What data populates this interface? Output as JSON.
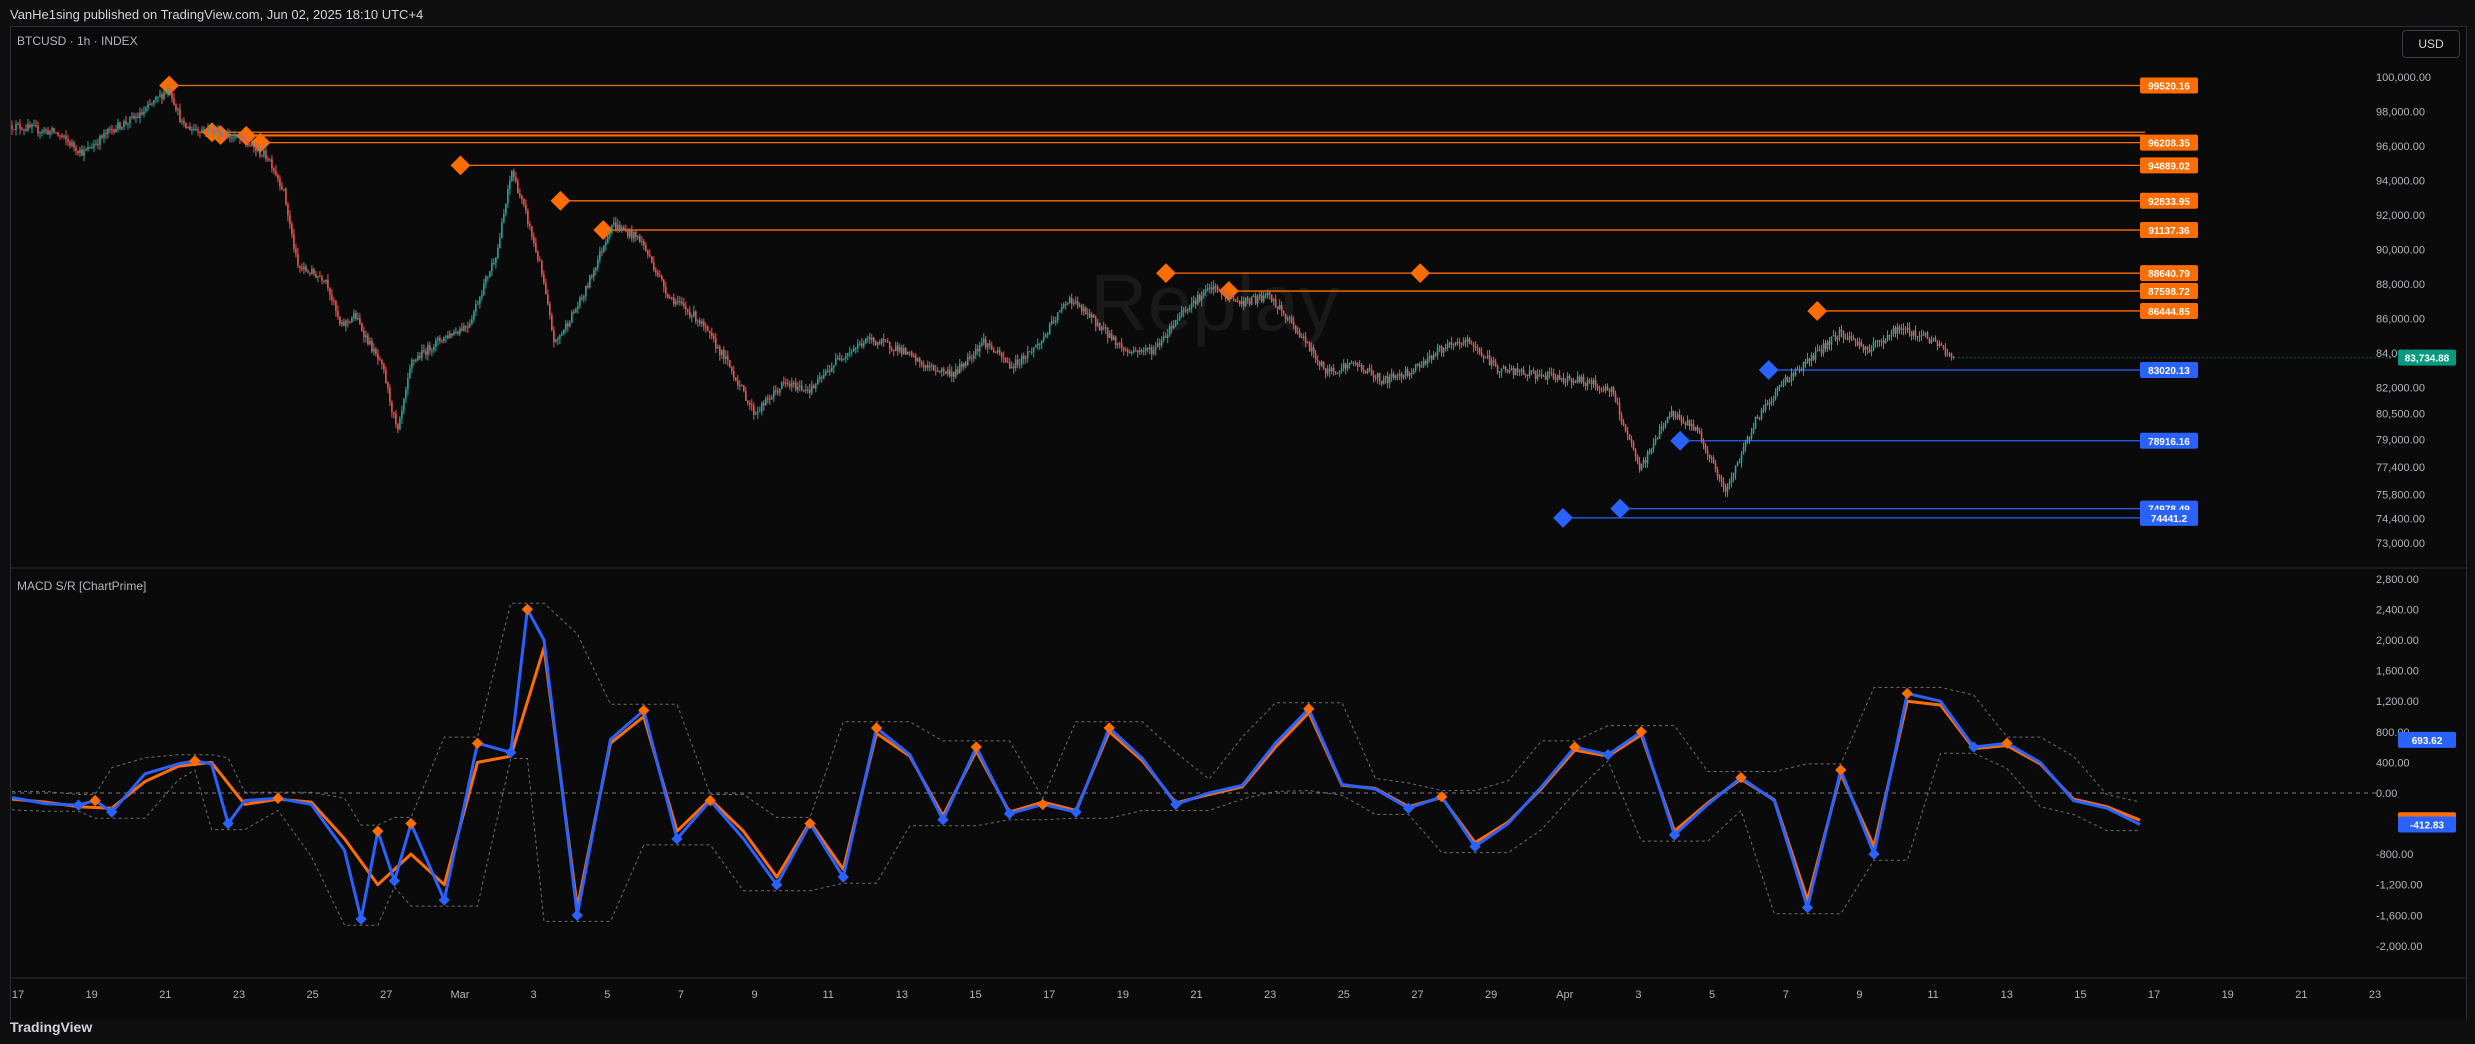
{
  "header": {
    "published": "VanHe1sing published on TradingView.com, Jun 02, 2025 18:10 UTC+4"
  },
  "footer": {
    "logo": "TradingView"
  },
  "price_pane": {
    "symbol": "BTCUSD · 1h · INDEX",
    "currency": "USD",
    "watermark": "Replay"
  },
  "macd_pane": {
    "title": "MACD S/R [ChartPrime]"
  },
  "colors": {
    "bull": "#26a69a",
    "bear": "#ef5350",
    "resistance": "#ff6d00",
    "support": "#2962ff",
    "macd": "#2962ff",
    "signal": "#ff6d00",
    "current_price": "#089981"
  },
  "chart_data": [
    {
      "type": "candlestick",
      "title": "BTCUSD · 1h · INDEX",
      "x_ticks": [
        "17",
        "19",
        "21",
        "23",
        "25",
        "27",
        "Mar",
        "3",
        "5",
        "7",
        "9",
        "11",
        "13",
        "15",
        "17",
        "19",
        "21",
        "23",
        "25",
        "27",
        "29",
        "Apr",
        "3",
        "5",
        "7",
        "9",
        "11",
        "13",
        "15",
        "17",
        "19",
        "21",
        "23"
      ],
      "y_ticks": [
        "100,000.00",
        "98,000.00",
        "96,000.00",
        "94,000.00",
        "92,000.00",
        "90,000.00",
        "88,000.00",
        "86,000.00",
        "84,000.00",
        "82,000.00",
        "80,500.00",
        "79,000.00",
        "77,400.00",
        "75,800.00",
        "74,400.00",
        "73,000.00"
      ],
      "y_tick_values": [
        100000,
        98000,
        96000,
        94000,
        92000,
        90000,
        88000,
        86000,
        84000,
        82000,
        80500,
        79000,
        77400,
        75800,
        74400,
        73000
      ],
      "ylim": [
        72000,
        101000
      ],
      "x_range": [
        0,
        74.5
      ],
      "close_path": [
        [
          0,
          97200
        ],
        [
          1.5,
          96800
        ],
        [
          2.5,
          95600
        ],
        [
          3.5,
          97000
        ],
        [
          4.5,
          97800
        ],
        [
          5.5,
          99400
        ],
        [
          6,
          97100
        ],
        [
          7,
          96900
        ],
        [
          8,
          96400
        ],
        [
          9,
          95300
        ],
        [
          9.5,
          93500
        ],
        [
          10,
          89000
        ],
        [
          11,
          88300
        ],
        [
          11.5,
          85500
        ],
        [
          12,
          86200
        ],
        [
          13,
          83000
        ],
        [
          13.5,
          79300
        ],
        [
          14,
          83500
        ],
        [
          15,
          84800
        ],
        [
          16,
          85700
        ],
        [
          17,
          90000
        ],
        [
          17.5,
          94600
        ],
        [
          18,
          92000
        ],
        [
          18.5,
          89000
        ],
        [
          19,
          84500
        ],
        [
          20,
          87300
        ],
        [
          21,
          91500
        ],
        [
          22,
          90600
        ],
        [
          23,
          87300
        ],
        [
          24,
          86000
        ],
        [
          25,
          83600
        ],
        [
          26,
          80500
        ],
        [
          27,
          82200
        ],
        [
          28,
          81900
        ],
        [
          29,
          83800
        ],
        [
          30,
          84800
        ],
        [
          31,
          84300
        ],
        [
          32,
          83200
        ],
        [
          33,
          82800
        ],
        [
          34,
          84700
        ],
        [
          35,
          83200
        ],
        [
          36,
          84600
        ],
        [
          37,
          87200
        ],
        [
          38,
          85700
        ],
        [
          39,
          84100
        ],
        [
          40,
          84200
        ],
        [
          41,
          86500
        ],
        [
          42,
          87800
        ],
        [
          43,
          86900
        ],
        [
          44,
          87300
        ],
        [
          45,
          85300
        ],
        [
          46,
          82900
        ],
        [
          47,
          83400
        ],
        [
          48,
          82400
        ],
        [
          49,
          83000
        ],
        [
          50,
          84200
        ],
        [
          51,
          84700
        ],
        [
          52,
          83100
        ],
        [
          53,
          82800
        ],
        [
          54,
          82600
        ],
        [
          55,
          82400
        ],
        [
          56,
          81800
        ],
        [
          57,
          77200
        ],
        [
          58,
          80500
        ],
        [
          59,
          79600
        ],
        [
          60,
          75900
        ],
        [
          61,
          80000
        ],
        [
          62,
          82300
        ],
        [
          63,
          83700
        ],
        [
          64,
          85200
        ],
        [
          65,
          84200
        ],
        [
          66,
          85400
        ],
        [
          67,
          85000
        ],
        [
          68,
          83700
        ]
      ],
      "resistance_levels": [
        {
          "start": 5.5,
          "value": 99520.16,
          "label": "99520.16"
        },
        {
          "start": 7.0,
          "value": 96808.89
        },
        {
          "start": 7.3,
          "value": 96646.51
        },
        {
          "start": 8.2,
          "value": 96600.62
        },
        {
          "start": 8.7,
          "value": 96208.35,
          "label": "96208.35"
        },
        {
          "start": 15.7,
          "value": 94889.02,
          "label": "94889.02"
        },
        {
          "start": 19.2,
          "value": 92833.95,
          "label": "92833.95"
        },
        {
          "start": 20.7,
          "value": 91137.36,
          "label": "91137.36"
        },
        {
          "start": 40.4,
          "value": 88640.79,
          "label": "88640.79"
        },
        {
          "start": 49.3,
          "value": 88640.79
        },
        {
          "start": 42.6,
          "value": 87598.72,
          "label": "87598.72"
        },
        {
          "start": 63.2,
          "value": 86444.85,
          "label": "86444.85"
        }
      ],
      "support_levels": [
        {
          "start": 61.5,
          "value": 83020.13,
          "label": "83020.13"
        },
        {
          "start": 58.4,
          "value": 78916.16,
          "label": "78916.16"
        },
        {
          "start": 56.3,
          "value": 74978.49,
          "label": "74978.49"
        },
        {
          "start": 54.3,
          "value": 74441.2,
          "label": "74441.2"
        }
      ],
      "current_price": {
        "value": 83734.88,
        "label": "83,734.88"
      }
    },
    {
      "type": "line",
      "title": "MACD S/R [ChartPrime]",
      "y_ticks": [
        "2,800.00",
        "2,400.00",
        "2,000.00",
        "1,600.00",
        "1,200.00",
        "800.00",
        "400.00",
        "0.00",
        "-800.00",
        "-1,200.00",
        "-1,600.00",
        "-2,000.00"
      ],
      "y_tick_values": [
        2800,
        2400,
        2000,
        1600,
        1200,
        800,
        400,
        0,
        -800,
        -1200,
        -1600,
        -2000
      ],
      "ylim": [
        -2250,
        2850
      ],
      "zero_line": true,
      "series": [
        {
          "values": [
            [
              0,
              -60
            ],
            [
              1,
              -140
            ],
            [
              2,
              -160
            ],
            [
              2.5,
              -100
            ],
            [
              3,
              -250
            ],
            [
              4,
              250
            ],
            [
              5,
              380
            ],
            [
              5.5,
              420
            ],
            [
              6,
              380
            ],
            [
              6.5,
              -400
            ],
            [
              7,
              -100
            ],
            [
              8,
              -70
            ],
            [
              9,
              -150
            ],
            [
              10,
              -750
            ],
            [
              10.5,
              -1650
            ],
            [
              11,
              -500
            ],
            [
              11.5,
              -1150
            ],
            [
              12,
              -400
            ],
            [
              13,
              -1400
            ],
            [
              14,
              650
            ],
            [
              15,
              530
            ],
            [
              15.5,
              2400
            ],
            [
              16,
              2000
            ],
            [
              17,
              -1600
            ],
            [
              18,
              700
            ],
            [
              19,
              1080
            ],
            [
              20,
              -600
            ],
            [
              21,
              -100
            ],
            [
              22,
              -600
            ],
            [
              23,
              -1200
            ],
            [
              24,
              -400
            ],
            [
              25,
              -1100
            ],
            [
              26,
              850
            ],
            [
              27,
              500
            ],
            [
              28,
              -350
            ],
            [
              29,
              600
            ],
            [
              30,
              -270
            ],
            [
              31,
              -150
            ],
            [
              32,
              -250
            ],
            [
              33,
              850
            ],
            [
              34,
              450
            ],
            [
              35,
              -150
            ],
            [
              36,
              0
            ],
            [
              37,
              100
            ],
            [
              38,
              650
            ],
            [
              39,
              1100
            ],
            [
              40,
              110
            ],
            [
              41,
              50
            ],
            [
              42,
              -200
            ],
            [
              43,
              -50
            ],
            [
              44,
              -700
            ],
            [
              45,
              -400
            ],
            [
              46,
              80
            ],
            [
              47,
              600
            ],
            [
              48,
              500
            ],
            [
              49,
              800
            ],
            [
              50,
              -550
            ],
            [
              51,
              -150
            ],
            [
              52,
              200
            ],
            [
              53,
              -100
            ],
            [
              54,
              -1500
            ],
            [
              55,
              300
            ],
            [
              56,
              -800
            ],
            [
              57,
              1300
            ],
            [
              58,
              1200
            ],
            [
              59,
              600
            ],
            [
              60,
              650
            ],
            [
              61,
              400
            ],
            [
              62,
              -100
            ],
            [
              63,
              -200
            ],
            [
              64,
              -413
            ]
          ]
        },
        {
          "values": [
            [
              0,
              -80
            ],
            [
              1,
              -120
            ],
            [
              2,
              -180
            ],
            [
              3,
              -200
            ],
            [
              4,
              150
            ],
            [
              5,
              350
            ],
            [
              6,
              400
            ],
            [
              7,
              -150
            ],
            [
              8,
              -80
            ],
            [
              9,
              -120
            ],
            [
              10,
              -600
            ],
            [
              11,
              -1200
            ],
            [
              12,
              -800
            ],
            [
              13,
              -1200
            ],
            [
              14,
              400
            ],
            [
              15,
              480
            ],
            [
              16,
              1900
            ],
            [
              17,
              -1500
            ],
            [
              18,
              650
            ],
            [
              19,
              1000
            ],
            [
              20,
              -500
            ],
            [
              21,
              -80
            ],
            [
              22,
              -500
            ],
            [
              23,
              -1100
            ],
            [
              24,
              -380
            ],
            [
              25,
              -1000
            ],
            [
              26,
              780
            ],
            [
              27,
              480
            ],
            [
              28,
              -300
            ],
            [
              29,
              550
            ],
            [
              30,
              -250
            ],
            [
              31,
              -120
            ],
            [
              32,
              -230
            ],
            [
              33,
              800
            ],
            [
              34,
              420
            ],
            [
              35,
              -130
            ],
            [
              36,
              -20
            ],
            [
              37,
              80
            ],
            [
              38,
              600
            ],
            [
              39,
              1050
            ],
            [
              40,
              100
            ],
            [
              41,
              60
            ],
            [
              42,
              -180
            ],
            [
              43,
              -60
            ],
            [
              44,
              -650
            ],
            [
              45,
              -380
            ],
            [
              46,
              60
            ],
            [
              47,
              560
            ],
            [
              48,
              480
            ],
            [
              49,
              760
            ],
            [
              50,
              -500
            ],
            [
              51,
              -130
            ],
            [
              52,
              180
            ],
            [
              53,
              -90
            ],
            [
              54,
              -1400
            ],
            [
              55,
              250
            ],
            [
              56,
              -700
            ],
            [
              57,
              1200
            ],
            [
              58,
              1150
            ],
            [
              59,
              580
            ],
            [
              60,
              620
            ],
            [
              61,
              380
            ],
            [
              62,
              -80
            ],
            [
              63,
              -180
            ],
            [
              64,
              -357
            ]
          ]
        }
      ],
      "last_values": [
        {
          "value": 693.62,
          "label": "693.62"
        },
        {
          "value": -356.79,
          "label": "-356.79"
        },
        {
          "value": -412.83,
          "label": "-412.83"
        }
      ]
    }
  ]
}
